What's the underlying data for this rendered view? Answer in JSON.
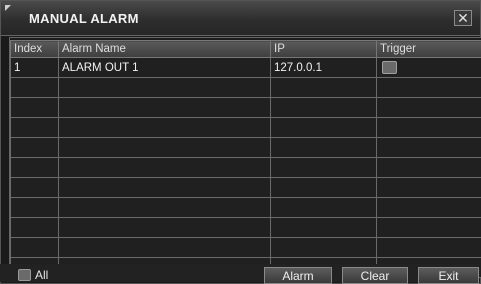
{
  "window": {
    "title": "MANUAL ALARM",
    "close_glyph": "✕"
  },
  "table": {
    "headers": [
      "Index",
      "Alarm Name",
      "IP",
      "Trigger"
    ],
    "rows": [
      {
        "index": "1",
        "name": "ALARM OUT 1",
        "ip": "127.0.0.1",
        "trigger_checked": false
      }
    ],
    "empty_rows": 10
  },
  "footer": {
    "all_label": "All",
    "alarm_label": "Alarm",
    "clear_label": "Clear",
    "exit_label": "Exit"
  }
}
